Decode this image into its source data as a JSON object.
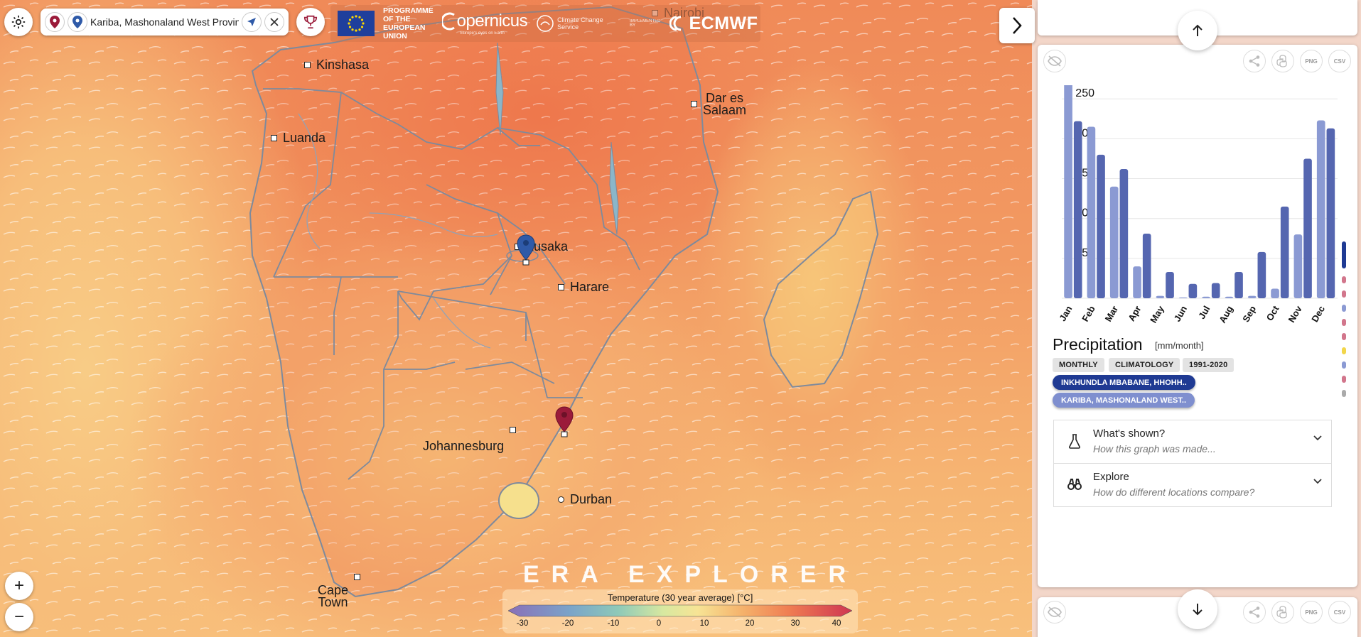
{
  "search": {
    "value": "Kariba, Mashonaland West Province"
  },
  "logos": {
    "eu": "PROGRAMME OF THE EUROPEAN UNION",
    "copernicus": "opernicus",
    "copernicus_sub": "Europe's eyes on Earth",
    "c3s": "Climate Change Service",
    "impl": "IMPLEMENTED BY",
    "ecmwf": "ECMWF"
  },
  "cities": {
    "kinshasa": "Kinshasa",
    "luanda": "Luanda",
    "dar_line1": "Dar es",
    "dar_line2": "Salaam",
    "nairobi": "Nairobi",
    "lusaka": "Lusaka",
    "harare": "Harare",
    "johannesburg": "Johannesburg",
    "durban": "Durban",
    "cape_line1": "Cape",
    "cape_line2": "Town"
  },
  "brand": "ERA EXPLORER",
  "legend": {
    "title": "Temperature  (30 year average)  [°C]",
    "ticks": [
      "-30",
      "-20",
      "-10",
      "0",
      "10",
      "20",
      "30",
      "40"
    ]
  },
  "zoom": {
    "in": "+",
    "out": "−"
  },
  "panel": {
    "tools": {
      "png": "PNG",
      "csv": "CSV"
    },
    "title": "Precipitation",
    "unit": "[mm/month]",
    "tags": [
      "MONTHLY",
      "CLIMATOLOGY",
      "1991-2020"
    ],
    "locations": [
      "INKHUNDLA MBABANE, HHOHH..",
      "KARIBA, MASHONALAND WEST.."
    ],
    "accordions": [
      {
        "title": "What's shown?",
        "subtitle": "How this graph was made..."
      },
      {
        "title": "Explore",
        "subtitle": "How do different locations compare?"
      }
    ]
  },
  "chart_data": {
    "type": "bar",
    "categories": [
      "Jan",
      "Feb",
      "Mar",
      "Apr",
      "May",
      "Jun",
      "Jul",
      "Aug",
      "Sep",
      "Oct",
      "Nov",
      "Dec"
    ],
    "series": [
      {
        "name": "Inkhundla Mbabane, Hhohho",
        "color": "#8b9ad3",
        "values": [
          275,
          215,
          140,
          40,
          3,
          1,
          2,
          2,
          3,
          12,
          80,
          223
        ]
      },
      {
        "name": "Kariba, Mashonaland West",
        "color": "#5566b0",
        "values": [
          222,
          180,
          162,
          81,
          33,
          18,
          19,
          33,
          58,
          115,
          175,
          213
        ]
      }
    ],
    "yticks": [
      "0",
      "50",
      "100",
      "150",
      "200",
      "250"
    ],
    "ylim": [
      0,
      260
    ],
    "grid": true
  },
  "colors": {
    "pin_red": "#9b1b3a",
    "pin_blue": "#2f5aa8",
    "pill_dark": "#1f3a93",
    "pill_light": "#7f8fcf"
  }
}
